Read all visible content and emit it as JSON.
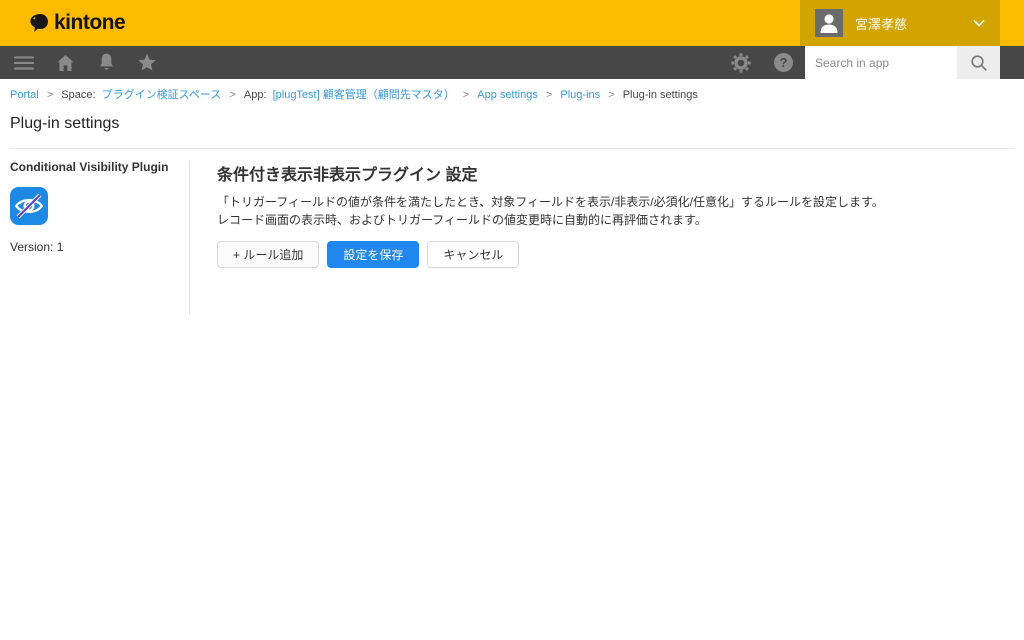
{
  "header": {
    "logo_text": "kintone",
    "user": {
      "name": "宮澤孝慈"
    }
  },
  "navbar": {
    "help_glyph": "?",
    "search": {
      "placeholder": "Search in app"
    }
  },
  "breadcrumb": {
    "separator": ">",
    "portal": "Portal",
    "space_prefix": "Space:",
    "space_name": "プラグイン検証スペース",
    "app_prefix": "App:",
    "app_name": "[plugTest] 顧客管理（顧問先マスタ）",
    "app_settings": "App settings",
    "plugins": "Plug-ins",
    "current": "Plug-in settings"
  },
  "page": {
    "title": "Plug-in settings"
  },
  "sidebar": {
    "plugin_name": "Conditional Visibility Plugin",
    "version": "Version: 1"
  },
  "main": {
    "title": "条件付き表示非表示プラグイン 設定",
    "description": [
      "「トリガーフィールドの値が条件を満たしたとき、対象フィールドを表示/非表示/必須化/任意化」するルールを設定します。",
      "レコード画面の表示時、およびトリガーフィールドの値変更時に自動的に再評価されます。"
    ],
    "buttons": {
      "add_rule": "+ ルール追加",
      "save": "設定を保存",
      "cancel": "キャンセル"
    }
  },
  "icons": {
    "logo": "kintone-bird-icon",
    "nav": [
      "hamburger-icon",
      "home-icon",
      "bell-icon",
      "star-icon",
      "gear-icon",
      "help-icon",
      "search-icon"
    ],
    "user": [
      "avatar",
      "chevron-down-icon"
    ],
    "plugin": "eye-off-icon"
  },
  "colors": {
    "header_yellow": "#fdbb00",
    "user_area_yellow": "#d2a400",
    "navbar_gray": "#474747",
    "nav_icon_gray": "#8a8a8a",
    "link_blue": "#3498db",
    "primary_button_blue": "#2087ee",
    "plugin_icon_blue": "#1e88e5",
    "slash_purple": "#5b3fd4"
  }
}
